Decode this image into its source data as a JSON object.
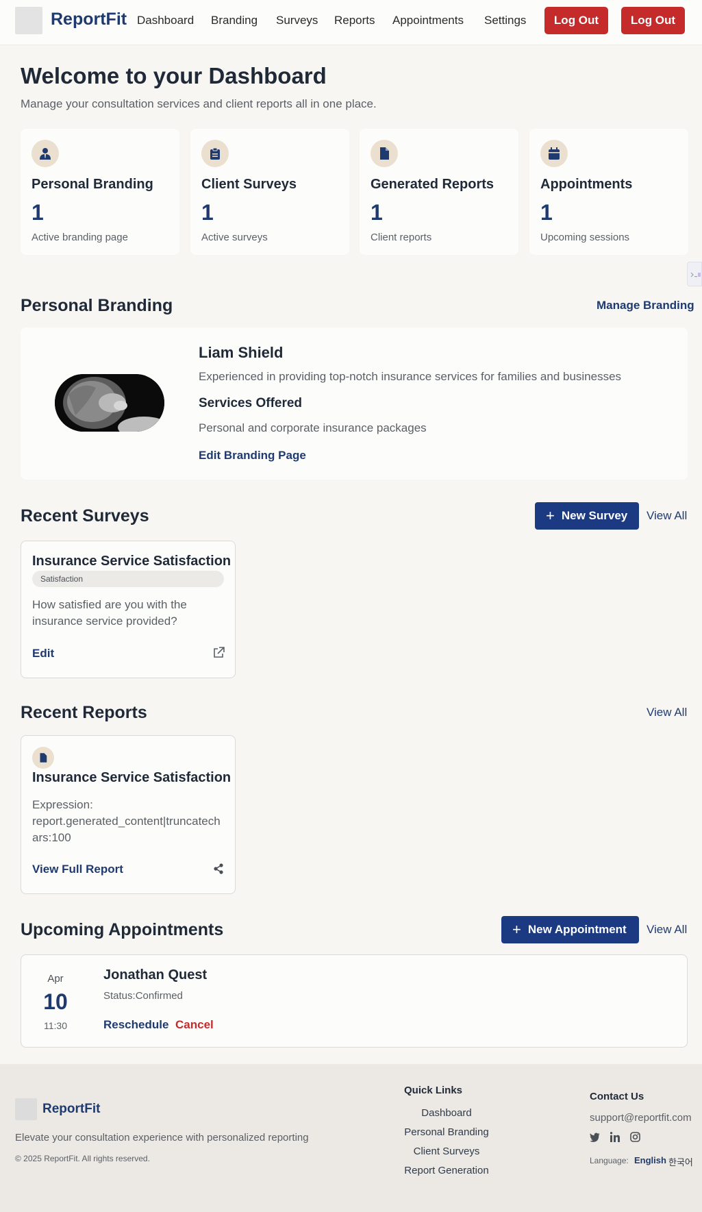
{
  "header": {
    "brand": "ReportFit",
    "nav": [
      "Dashboard",
      "Branding",
      "Surveys",
      "Reports",
      "Appointments",
      "Settings"
    ],
    "logout_label": "Log Out",
    "logout_label_2": "Log Out"
  },
  "hero": {
    "title": "Welcome to your Dashboard",
    "subtitle": "Manage your consultation services and client reports all in one place."
  },
  "stats": [
    {
      "title": "Personal Branding",
      "value": "1",
      "desc": "Active branding page",
      "icon": "user-tie-icon"
    },
    {
      "title": "Client Surveys",
      "value": "1",
      "desc": "Active surveys",
      "icon": "clipboard-icon"
    },
    {
      "title": "Generated Reports",
      "value": "1",
      "desc": "Client reports",
      "icon": "file-icon"
    },
    {
      "title": "Appointments",
      "value": "1",
      "desc": "Upcoming sessions",
      "icon": "calendar-icon"
    }
  ],
  "branding": {
    "heading": "Personal Branding",
    "manage_label": "Manage Branding",
    "name": "Liam Shield",
    "bio": "Experienced in providing top-notch insurance services for families and businesses",
    "services_heading": "Services Offered",
    "services": "Personal and corporate insurance packages",
    "edit_label": "Edit Branding Page"
  },
  "surveys": {
    "heading": "Recent Surveys",
    "new_label": "New Survey",
    "view_all": "View All",
    "items": [
      {
        "title": "Insurance Service Satisfaction",
        "tag": "Satisfaction",
        "question": "How satisfied are you with the insurance service provided?",
        "edit_label": "Edit"
      }
    ]
  },
  "reports": {
    "heading": "Recent Reports",
    "view_all": "View All",
    "items": [
      {
        "title": "Insurance Service Satisfaction",
        "body_line1": "Expression:",
        "body_line2": "report.generated_content|truncatech",
        "body_line3": "ars:100",
        "view_label": "View Full Report"
      }
    ]
  },
  "appointments": {
    "heading": "Upcoming Appointments",
    "new_label": "New Appointment",
    "view_all": "View All",
    "items": [
      {
        "month": "Apr",
        "day": "10",
        "time": "11:30",
        "client": "Jonathan Quest",
        "status": "Status:Confirmed",
        "reschedule_label": "Reschedule",
        "cancel_label": "Cancel"
      }
    ]
  },
  "footer": {
    "brand": "ReportFit",
    "tagline": "Elevate your consultation experience with personalized reporting",
    "copyright": "© 2025 ReportFit. All rights reserved.",
    "quick_links_heading": "Quick Links",
    "quick_links": [
      "Dashboard",
      "Personal Branding",
      "Client Surveys",
      "Report Generation"
    ],
    "contact_heading": "Contact Us",
    "email": "support@reportfit.com",
    "language_label": "Language:",
    "languages": [
      "English",
      "한국어"
    ]
  },
  "colors": {
    "navy": "#1e3a6e",
    "red": "#c62b2b",
    "beige": "#ebe0cf"
  }
}
